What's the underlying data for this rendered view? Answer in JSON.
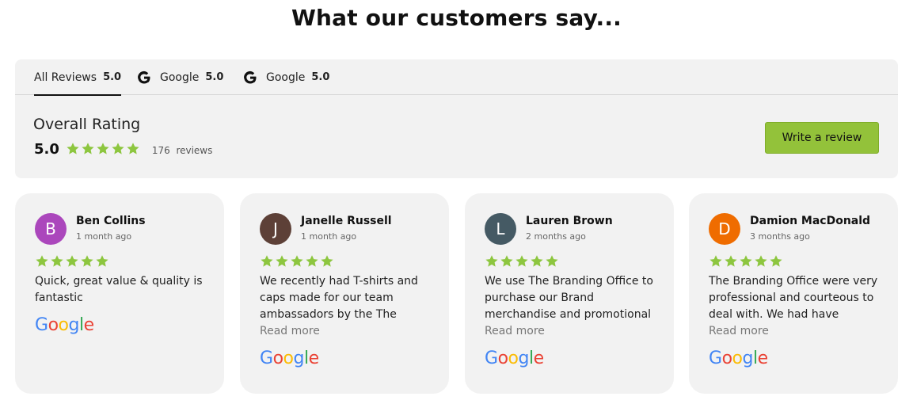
{
  "heading": "What our customers say...",
  "tabs": [
    {
      "label": "All Reviews",
      "score": "5.0"
    },
    {
      "label": "Google",
      "score": "5.0"
    },
    {
      "label": "Google",
      "score": "5.0"
    }
  ],
  "overall": {
    "title": "Overall Rating",
    "score": "5.0",
    "stars": 5,
    "count": "176",
    "count_label": "reviews"
  },
  "write_button": "Write a review",
  "read_more": "Read more",
  "google_letters": [
    "G",
    "o",
    "o",
    "g",
    "l",
    "e"
  ],
  "colors": {
    "accent": "#93c23a",
    "star": "#8dc63f",
    "google_blue": "#4285F4",
    "google_red": "#EA4335",
    "google_yellow": "#FBBC05",
    "google_green": "#34A853"
  },
  "reviews": [
    {
      "initial": "B",
      "name": "Ben Collins",
      "time": "1 month ago",
      "text": "Quick, great value & quality is fantastic",
      "avatar_color": "#ab47bc"
    },
    {
      "initial": "J",
      "name": "Janelle Russell",
      "time": "1 month ago",
      "text": "We recently had T-shirts and caps made for our team ambassadors by the The",
      "avatar_color": "#5d4037"
    },
    {
      "initial": "L",
      "name": "Lauren Brown",
      "time": "2 months ago",
      "text": "We use The Branding Office to purchase our Brand merchandise and promotional",
      "avatar_color": "#455a64"
    },
    {
      "initial": "D",
      "name": "Damion MacDonald",
      "time": "3 months ago",
      "text": "The Branding Office were very professional and courteous to deal with. We had have",
      "avatar_color": "#ef6c00"
    }
  ]
}
